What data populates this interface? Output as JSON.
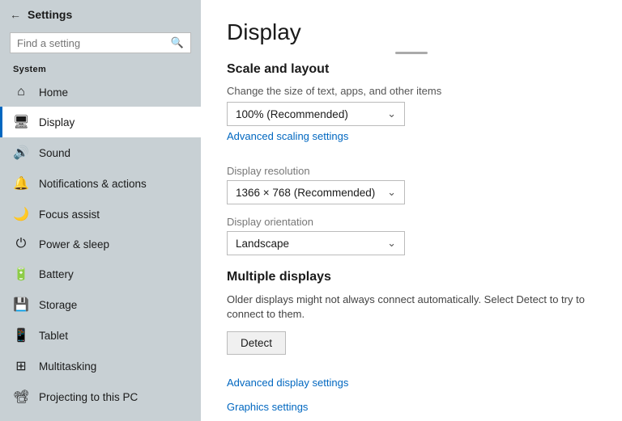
{
  "sidebar": {
    "title": "Settings",
    "search_placeholder": "Find a setting",
    "section_label": "System",
    "items": [
      {
        "id": "home",
        "label": "Home",
        "icon": "⌂"
      },
      {
        "id": "display",
        "label": "Display",
        "icon": "🖥",
        "active": true
      },
      {
        "id": "sound",
        "label": "Sound",
        "icon": "🔊"
      },
      {
        "id": "notifications",
        "label": "Notifications & actions",
        "icon": "🔔"
      },
      {
        "id": "focus",
        "label": "Focus assist",
        "icon": "🌙"
      },
      {
        "id": "power",
        "label": "Power & sleep",
        "icon": "⏻"
      },
      {
        "id": "battery",
        "label": "Battery",
        "icon": "🔋"
      },
      {
        "id": "storage",
        "label": "Storage",
        "icon": "💾"
      },
      {
        "id": "tablet",
        "label": "Tablet",
        "icon": "📱"
      },
      {
        "id": "multitasking",
        "label": "Multitasking",
        "icon": "⊞"
      },
      {
        "id": "projecting",
        "label": "Projecting to this PC",
        "icon": "📽"
      }
    ]
  },
  "main": {
    "page_title": "Display",
    "scroll_indicator": "",
    "scale_section": {
      "heading": "Scale and layout",
      "change_size_label": "Change the size of text, apps, and other items",
      "scale_value": "100% (Recommended)",
      "advanced_scaling_link": "Advanced scaling settings",
      "resolution_label": "Display resolution",
      "resolution_value": "1366 × 768 (Recommended)",
      "orientation_label": "Display orientation",
      "orientation_value": "Landscape"
    },
    "multiple_displays_section": {
      "heading": "Multiple displays",
      "description": "Older displays might not always connect automatically. Select Detect to try to connect to them.",
      "detect_button": "Detect",
      "advanced_display_link": "Advanced display settings",
      "graphics_link": "Graphics settings"
    }
  }
}
